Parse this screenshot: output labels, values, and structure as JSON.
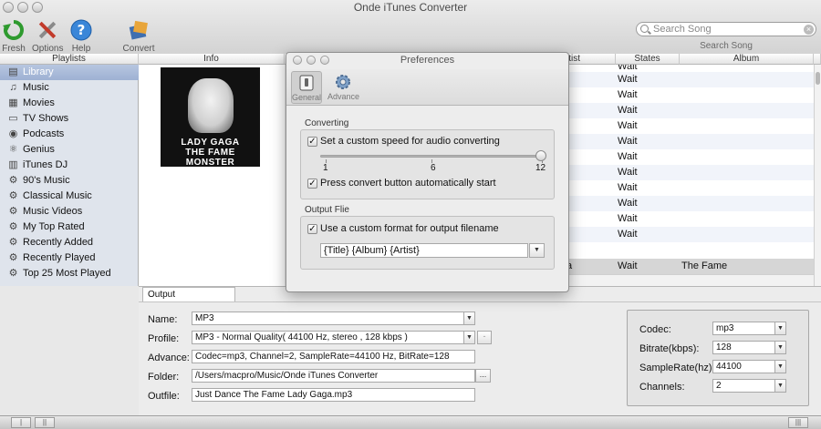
{
  "window": {
    "title": "Onde iTunes Converter"
  },
  "toolbar": {
    "fresh": "Fresh",
    "options": "Options",
    "help": "Help",
    "convert": "Convert"
  },
  "search": {
    "placeholder": "Search Song",
    "label": "Search Song"
  },
  "columns": {
    "playlists": "Playlists",
    "info": "Info",
    "artist": "tist",
    "states": "States",
    "album": "Album"
  },
  "sidebar": {
    "items": [
      {
        "label": "Library",
        "icon": "library-icon"
      },
      {
        "label": "Music",
        "icon": "music-note-icon"
      },
      {
        "label": "Movies",
        "icon": "film-icon"
      },
      {
        "label": "TV Shows",
        "icon": "tv-icon"
      },
      {
        "label": "Podcasts",
        "icon": "podcast-icon"
      },
      {
        "label": "Genius",
        "icon": "genius-icon"
      },
      {
        "label": "iTunes DJ",
        "icon": "dj-icon"
      },
      {
        "label": "90's Music",
        "icon": "gear-icon"
      },
      {
        "label": "Classical Music",
        "icon": "gear-icon"
      },
      {
        "label": "Music Videos",
        "icon": "gear-icon"
      },
      {
        "label": "My Top Rated",
        "icon": "gear-icon"
      },
      {
        "label": "Recently Added",
        "icon": "gear-icon"
      },
      {
        "label": "Recently Played",
        "icon": "gear-icon"
      },
      {
        "label": "Top 25 Most Played",
        "icon": "gear-icon"
      }
    ]
  },
  "album_art": {
    "line1": "LADY GAGA",
    "line2": "THE FAME MONSTER"
  },
  "table": {
    "rows": [
      {
        "artist": "",
        "state": "Wait",
        "album": ""
      },
      {
        "artist": "",
        "state": "Wait",
        "album": ""
      },
      {
        "artist": "",
        "state": "Wait",
        "album": ""
      },
      {
        "artist": "",
        "state": "Wait",
        "album": ""
      },
      {
        "artist": "",
        "state": "Wait",
        "album": ""
      },
      {
        "artist": "",
        "state": "Wait",
        "album": ""
      },
      {
        "artist": "",
        "state": "Wait",
        "album": ""
      },
      {
        "artist": "",
        "state": "Wait",
        "album": ""
      },
      {
        "artist": "",
        "state": "Wait",
        "album": ""
      },
      {
        "artist": "",
        "state": "Wait",
        "album": ""
      },
      {
        "artist": "",
        "state": "Wait",
        "album": ""
      },
      {
        "artist": "",
        "state": "Wait",
        "album": ""
      },
      {
        "artist": "a",
        "state": "Wait",
        "album": "The Fame"
      }
    ]
  },
  "output": {
    "tab": "Output",
    "name_label": "Name:",
    "name_value": "MP3",
    "profile_label": "Profile:",
    "profile_value": "MP3 - Normal Quality( 44100 Hz, stereo , 128 kbps )",
    "profile_btn": "-",
    "advance_label": "Advance:",
    "advance_value": "Codec=mp3, Channel=2, SampleRate=44100 Hz, BitRate=128",
    "folder_label": "Folder:",
    "folder_value": "/Users/macpro/Music/Onde iTunes Converter",
    "folder_btn": "...",
    "outfile_label": "Outfile:",
    "outfile_value": "Just Dance  The Fame Lady Gaga.mp3"
  },
  "codec": {
    "codec_label": "Codec:",
    "codec_value": "mp3",
    "bitrate_label": "Bitrate(kbps):",
    "bitrate_value": "128",
    "samplerate_label": "SampleRate(hz):",
    "samplerate_value": "44100",
    "channels_label": "Channels:",
    "channels_value": "2"
  },
  "preferences": {
    "title": "Preferences",
    "tab_general": "General",
    "tab_advance": "Advance",
    "converting_group": "Converting",
    "custom_speed": "Set a custom speed for audio converting",
    "slider_min": "1",
    "slider_mid": "6",
    "slider_max": "12",
    "slider_value": 12,
    "auto_start": "Press convert button automatically start",
    "output_group": "Output Flie",
    "custom_format": "Use a custom format for output filename",
    "format_value": "{Title}  {Album} {Artist}"
  },
  "status": {
    "btn1": "|",
    "btn2": "||",
    "btn3": "|||"
  }
}
